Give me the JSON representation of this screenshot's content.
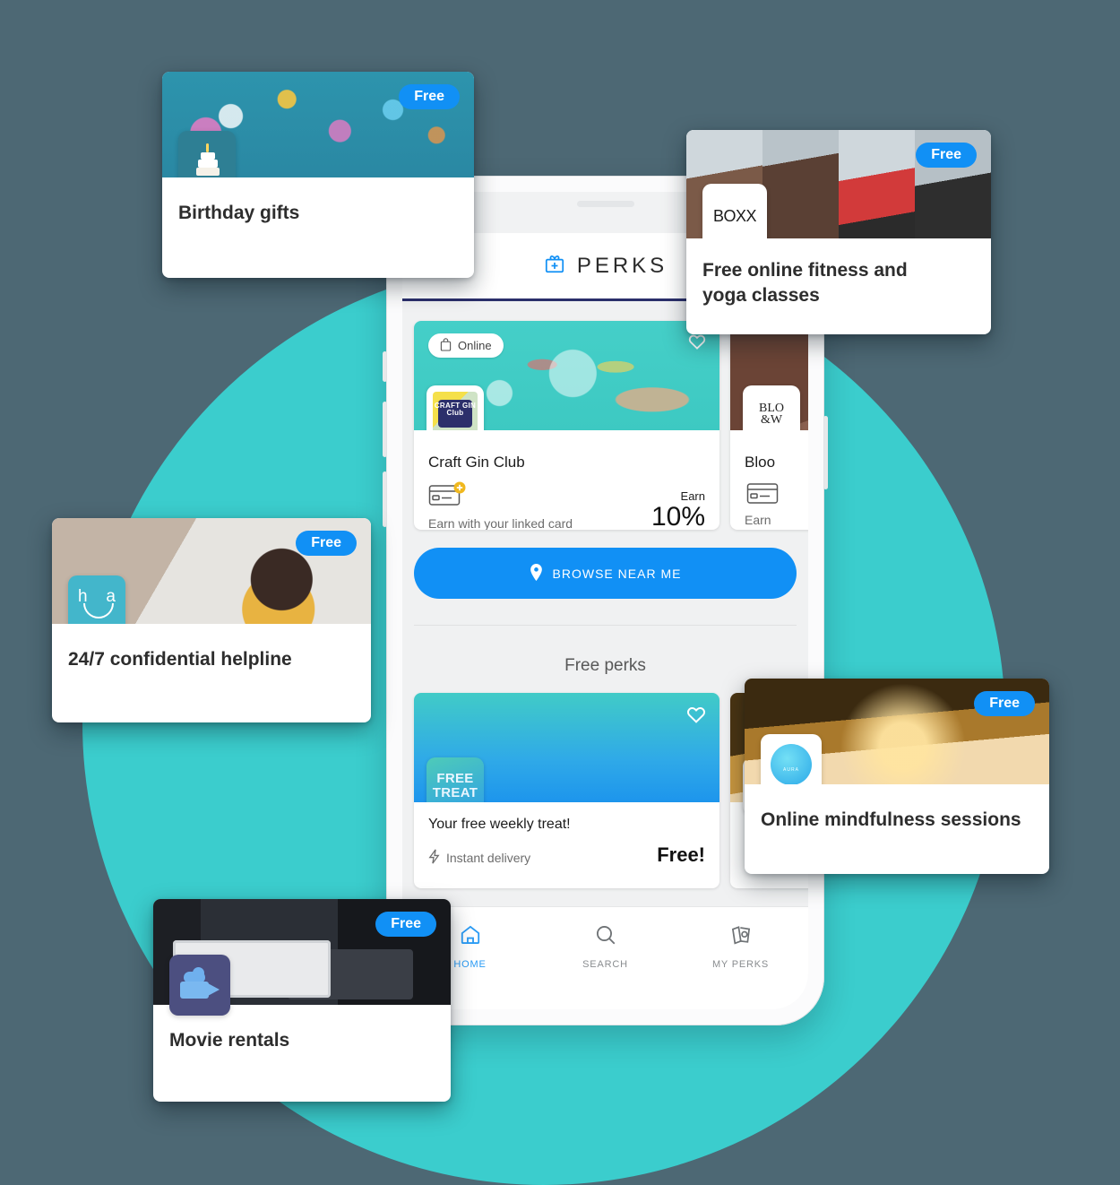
{
  "theme": {
    "background": "#4d6874",
    "blob_teal": "#3bcdcd",
    "accent_blue": "#1190f5",
    "header_rule_navy": "#2b2f6b"
  },
  "phone": {
    "app": {
      "title": "PERKS",
      "logo_icon": "gift-box-icon"
    },
    "merchant_cards": [
      {
        "badge": "Online",
        "badge_icon": "shopping-bag-icon",
        "logo_text": "CRAFT GIN Club",
        "name": "Craft Gin Club",
        "earn_caption": "Earn with your linked card",
        "earn_label": "Earn",
        "earn_value": "10%",
        "card_icon": "linked-card-icon"
      },
      {
        "logo_text": "BLOOM & WILD",
        "name": "Bloo",
        "earn_caption": "Earn",
        "card_icon": "linked-card-icon"
      }
    ],
    "browse_button": {
      "label": "BROWSE NEAR ME",
      "icon": "location-pin-icon"
    },
    "section_title": "Free perks",
    "free_perks": [
      {
        "tile_text": "FREE TREAT",
        "title": "Your free weekly treat!",
        "subtitle": "Instant delivery",
        "subtitle_icon": "lightning-bolt-icon",
        "price": "Free!",
        "favourite_icon": "heart-icon"
      },
      {
        "logo_text": "AURA",
        "title": "Online mindfulness sessions"
      }
    ],
    "bottom_nav": [
      {
        "label": "HOME",
        "icon": "home-icon",
        "active": true
      },
      {
        "label": "SEARCH",
        "icon": "search-icon",
        "active": false
      },
      {
        "label": "MY PERKS",
        "icon": "tickets-icon",
        "active": false
      }
    ]
  },
  "floating_cards": [
    {
      "badge": "Free",
      "title": "Birthday gifts",
      "logo_icon": "birthday-cake-icon"
    },
    {
      "badge": "Free",
      "title": "Free online fitness and yoga classes",
      "logo_text": "BOXX"
    },
    {
      "badge": "Free",
      "title": "24/7 confidential helpline",
      "logo_text": "h a"
    },
    {
      "badge": "Free",
      "title": "Online mindfulness sessions",
      "logo_text": "AURA"
    },
    {
      "badge": "Free",
      "title": "Movie rentals",
      "logo_icon": "movie-camera-icon"
    }
  ]
}
